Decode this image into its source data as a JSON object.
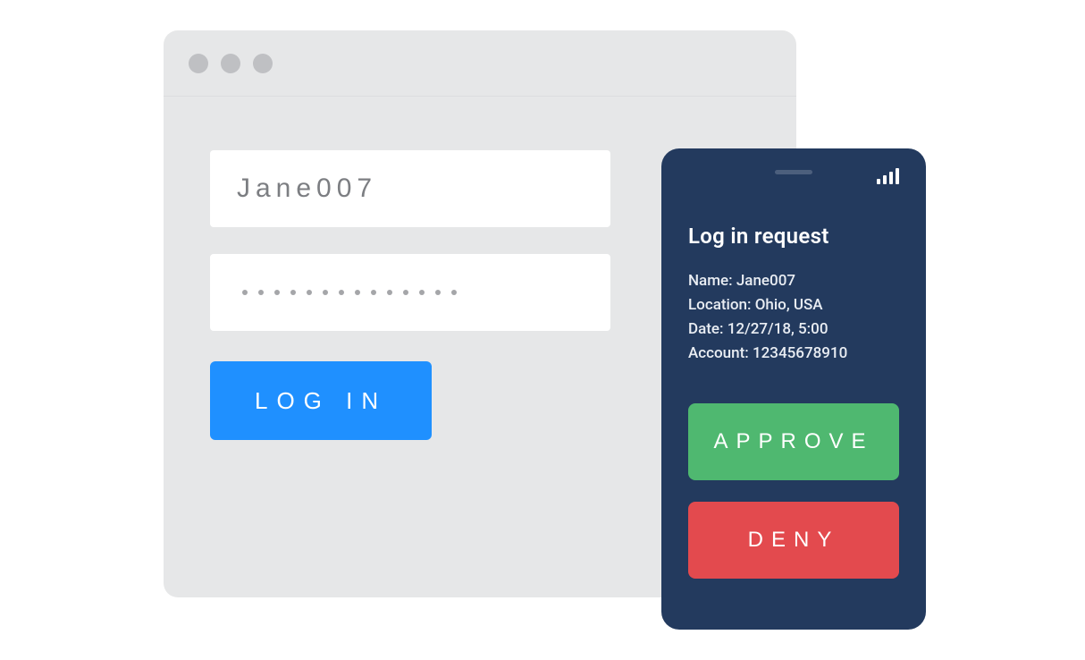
{
  "browser": {
    "form": {
      "username_value": "Jane007",
      "password_masked_dot_count": 14,
      "login_button_label": "LOG IN"
    }
  },
  "phone": {
    "title": "Log in request",
    "details": {
      "name_label": "Name:",
      "name_value": "Jane007",
      "location_label": "Location:",
      "location_value": "Ohio, USA",
      "date_label": "Date:",
      "date_value": "12/27/18, 5:00",
      "account_label": "Account:",
      "account_value": "12345678910"
    },
    "approve_label": "APPROVE",
    "deny_label": "DENY"
  },
  "colors": {
    "browser_bg": "#e6e7e8",
    "phone_bg": "#233a5e",
    "login_btn": "#1f90ff",
    "approve_btn": "#4fb870",
    "deny_btn": "#e34a4e"
  }
}
